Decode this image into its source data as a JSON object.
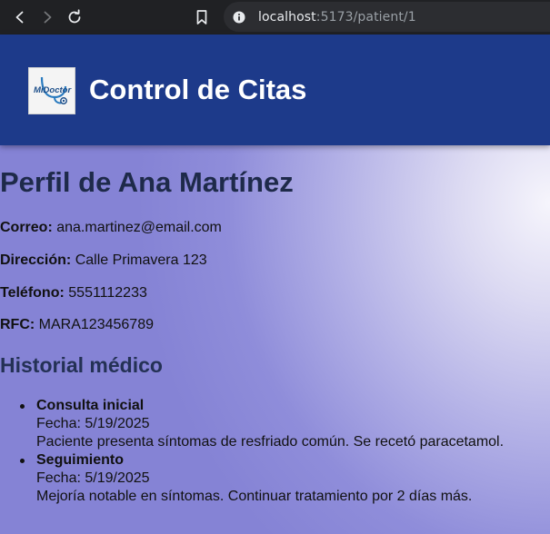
{
  "browser": {
    "url_host": "localhost",
    "url_path": ":5173/patient/1",
    "icons": [
      "back-icon",
      "forward-icon",
      "reload-icon",
      "bookmark-icon",
      "site-info-icon"
    ]
  },
  "header": {
    "logo_text": "MiDoctor",
    "title": "Control de Citas",
    "background_color": "#1d3a8a"
  },
  "profile": {
    "heading": "Perfil de Ana Martínez",
    "fields": [
      {
        "label": "Correo:",
        "value": "ana.martinez@email.com"
      },
      {
        "label": "Dirección:",
        "value": "Calle Primavera 123"
      },
      {
        "label": "Teléfono:",
        "value": "5551112233"
      },
      {
        "label": "RFC:",
        "value": "MARA123456789"
      }
    ]
  },
  "history": {
    "heading": "Historial médico",
    "entries": [
      {
        "title": "Consulta inicial",
        "date": "Fecha: 5/19/2025",
        "notes": "Paciente presenta síntomas de resfriado común. Se recetó paracetamol."
      },
      {
        "title": "Seguimiento",
        "date": "Fecha: 5/19/2025",
        "notes": "Mejoría notable en síntomas. Continuar tratamiento por 2 días más."
      }
    ]
  }
}
